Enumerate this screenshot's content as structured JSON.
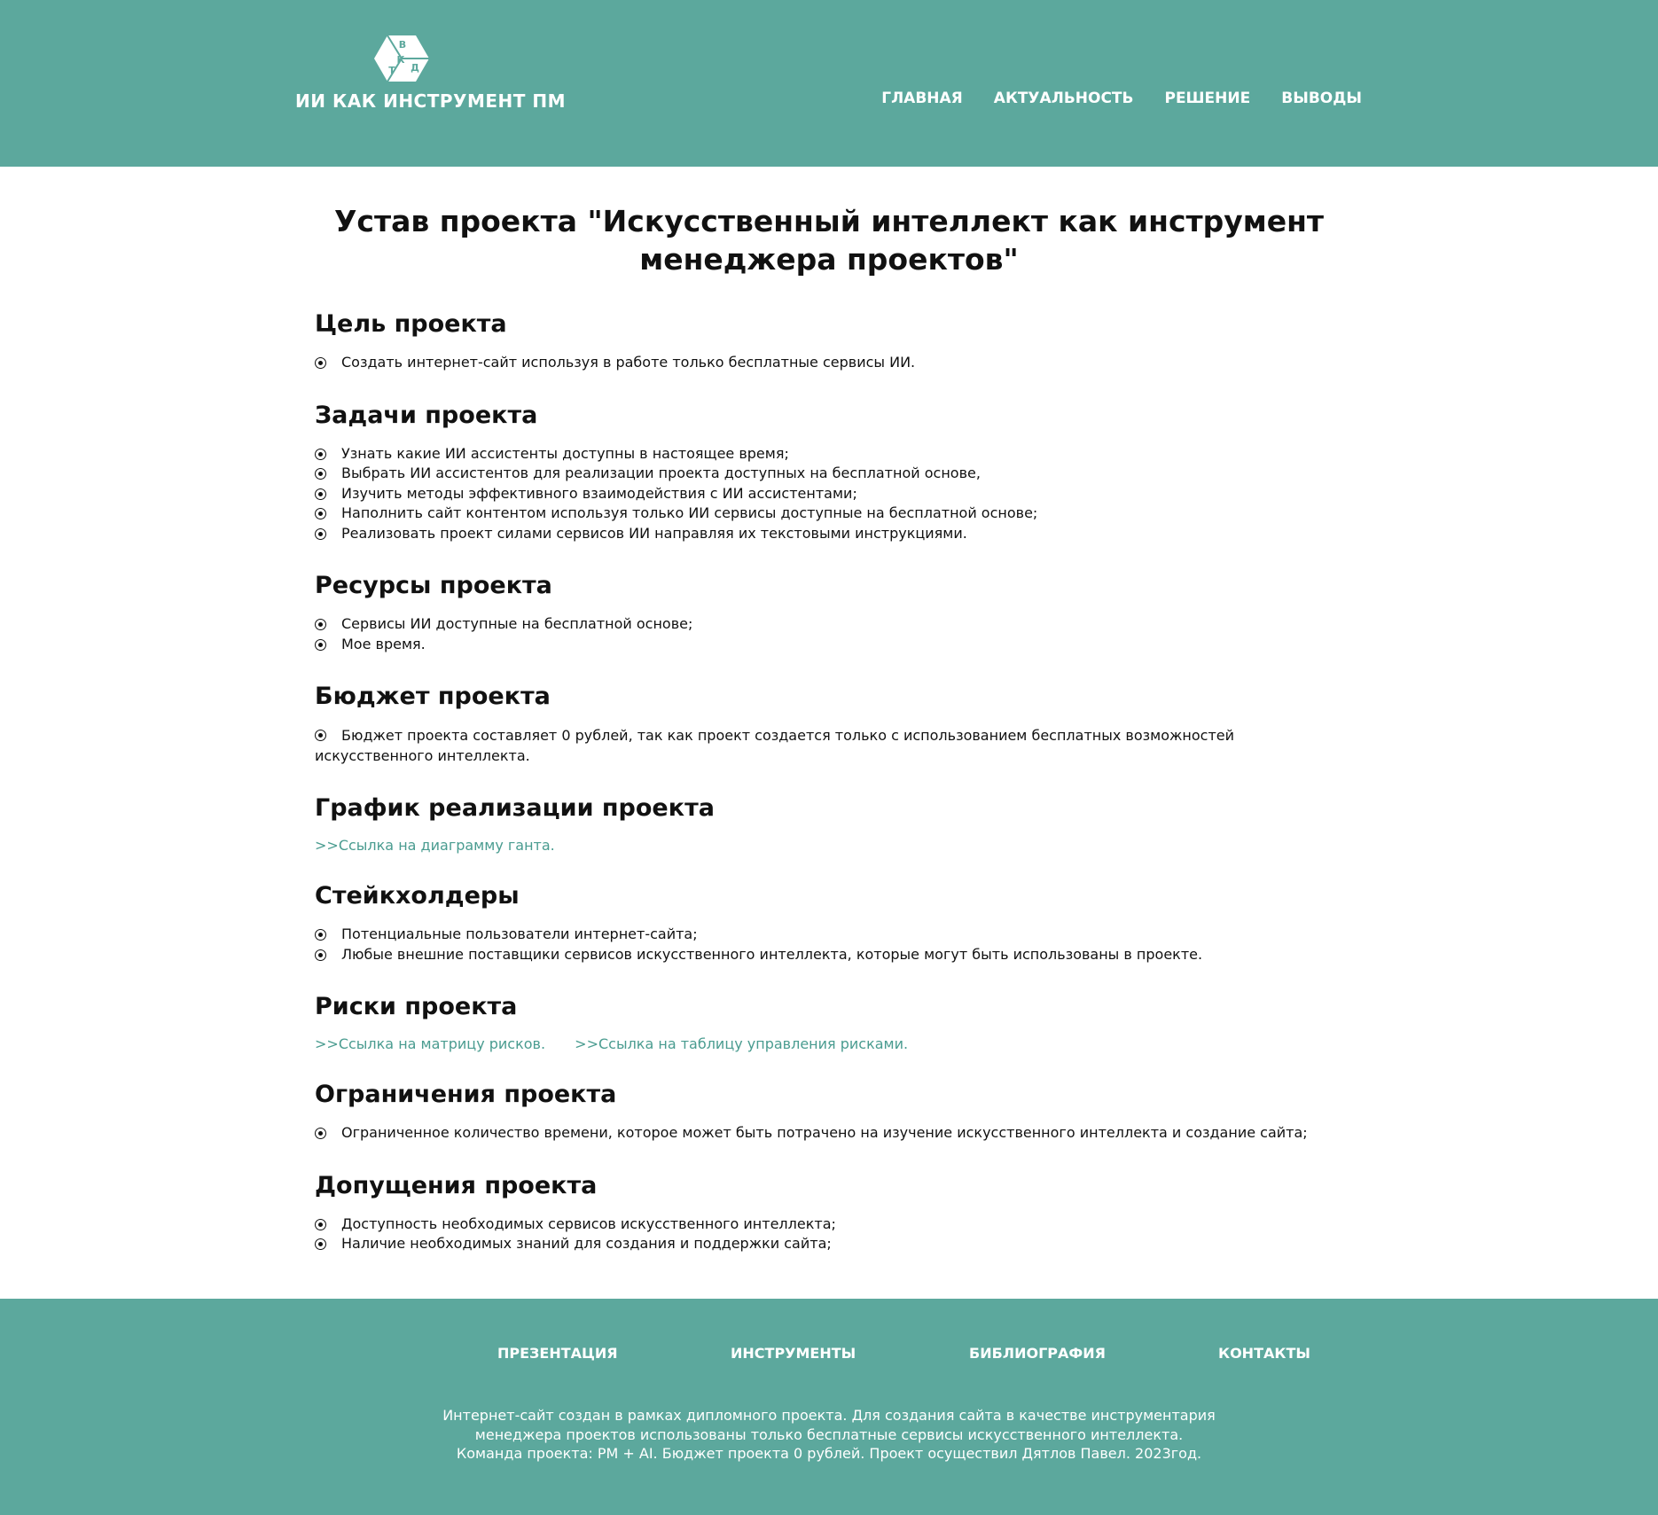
{
  "header": {
    "logo_letters": [
      "В",
      "К",
      "Т",
      "Д"
    ],
    "site_name": "ИИ КАК ИНСТРУМЕНТ ПМ",
    "nav": [
      "ГЛАВНАЯ",
      "АКТУАЛЬНОСТЬ",
      "РЕШЕНИЕ",
      "ВЫВОДЫ"
    ]
  },
  "main": {
    "title": "Устав проекта \"Искусственный интеллект как инструмент менеджера проектов\"",
    "goal": {
      "heading": "Цель проекта",
      "items": [
        "Создать интернет-сайт используя в работе только бесплатные сервисы ИИ."
      ]
    },
    "tasks": {
      "heading": "Задачи проекта",
      "items": [
        "Узнать какие ИИ ассистенты доступны в настоящее время;",
        "Выбрать ИИ ассистентов для реализации проекта доступных на бесплатной основе,",
        "Изучить методы эффективного взаимодействия с ИИ ассистентами;",
        "Наполнить сайт контентом используя только ИИ сервисы доступные на бесплатной основе;",
        "Реализовать проект силами сервисов ИИ направляя их текстовыми инструкциями."
      ]
    },
    "resources": {
      "heading": "Ресурсы проекта",
      "items": [
        "Сервисы ИИ доступные на бесплатной основе;",
        "Мое время."
      ]
    },
    "budget": {
      "heading": "Бюджет проекта",
      "text": "Бюджет проекта составляет 0 рублей, так как проект создается только с использованием бесплатных возможностей искусственного интеллекта."
    },
    "schedule": {
      "heading": "График реализации проекта",
      "link": ">>Ссылка на диаграмму ганта."
    },
    "stakeholders": {
      "heading": "Стейкхолдеры",
      "items": [
        "Потенциальные пользователи интернет-сайта;",
        "Любые внешние поставщики сервисов искусственного интеллекта, которые могут быть использованы в проекте."
      ]
    },
    "risks": {
      "heading": "Риски проекта",
      "link_matrix": ">>Ссылка на матрицу рисков.",
      "link_table": ">>Ссылка на таблицу управления рисками."
    },
    "constraints": {
      "heading": "Ограничения проекта",
      "items": [
        "Ограниченное количество времени, которое может быть потрачено на изучение искусственного интеллекта и создание сайта;"
      ]
    },
    "assumptions": {
      "heading": "Допущения проекта",
      "items": [
        "Доступность необходимых сервисов искусственного интеллекта;",
        "Наличие необходимых знаний для создания и поддержки сайта;"
      ]
    }
  },
  "footer": {
    "nav": [
      "ПРЕЗЕНТАЦИЯ",
      "ИНСТРУМЕНТЫ",
      "БИБЛИОГРАФИЯ",
      "КОНТАКТЫ"
    ],
    "text_lines": [
      "Интернет-сайт создан в рамках дипломного проекта. Для создания сайта в качестве инструментария",
      "менеджера проектов использованы только бесплатные сервисы искусственного интеллекта.",
      "Команда проекта: PM + AI. Бюджет проекта 0 рублей. Проект осуществил Дятлов Павел. 2023год."
    ]
  },
  "colors": {
    "accent": "#5ca89d",
    "link": "#4a9c90",
    "text": "#111111"
  }
}
